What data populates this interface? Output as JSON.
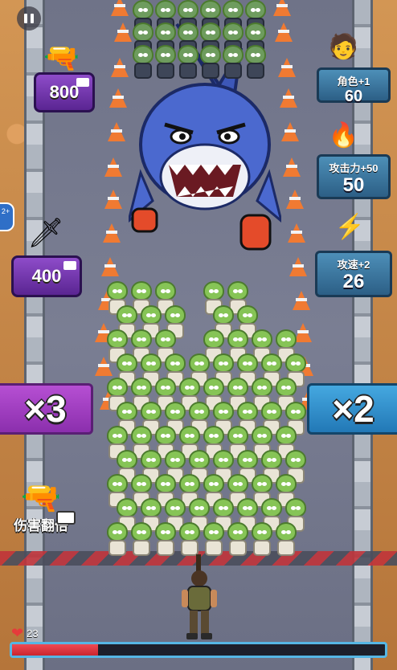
{
  "hud": {
    "pause_label": "Pause",
    "hp_value": "23",
    "hp_fraction": 0.23
  },
  "pickups": [
    {
      "value": "800",
      "icon": "rifle-icon"
    },
    {
      "value": "400",
      "icon": "knife-icon"
    }
  ],
  "upgrades": [
    {
      "label": "角色+1",
      "value": "60",
      "icon": "soldier-avatar-icon"
    },
    {
      "label": "攻击力+50",
      "value": "50",
      "icon": "bullet-fire-icon"
    },
    {
      "label": "攻速+2",
      "value": "26",
      "icon": "bullet-speed-icon"
    }
  ],
  "gates": {
    "left": "×3",
    "right": "×2"
  },
  "damage_double": {
    "label": "伤害翻倍",
    "icon": "pistol-icon"
  },
  "side_badge": "2+",
  "colors": {
    "hp_fill": "#c9262f",
    "hp_border": "#56b6e4",
    "gate_left": "#8b2fad",
    "gate_right": "#2278b6"
  }
}
